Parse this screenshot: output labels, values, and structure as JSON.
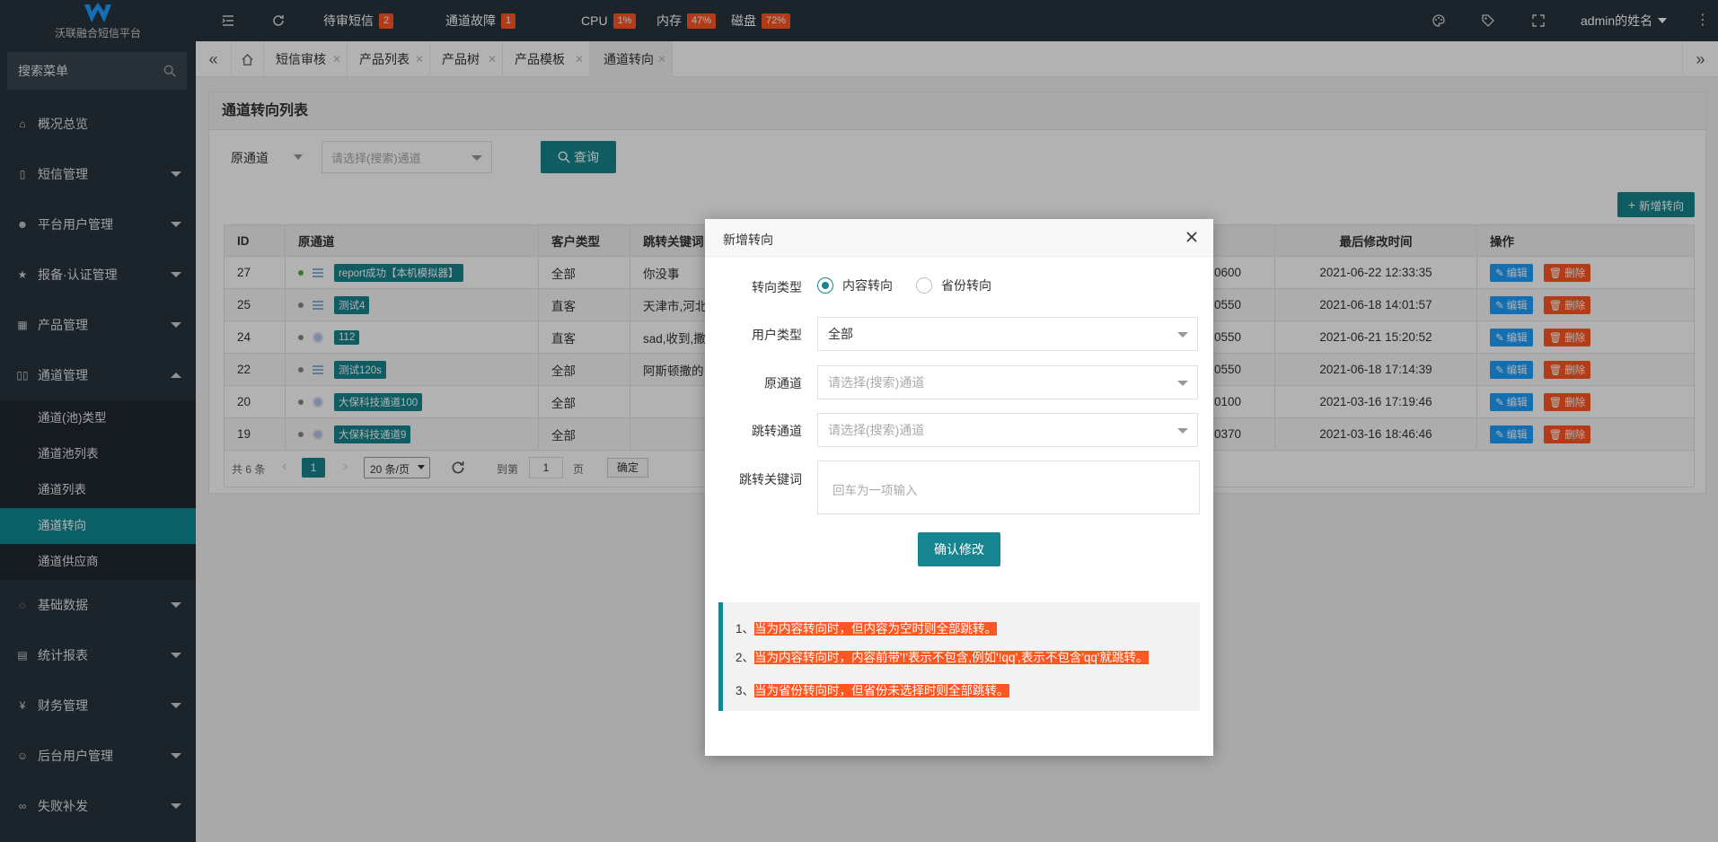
{
  "app": {
    "title": "沃联融合短信平台"
  },
  "sidebar": {
    "search_label": "搜索菜单",
    "items": [
      {
        "label": "概况总览",
        "icon": "home-icon"
      },
      {
        "label": "短信管理",
        "icon": "phone-icon"
      },
      {
        "label": "平台用户管理",
        "icon": "users-icon"
      },
      {
        "label": "报备·认证管理",
        "icon": "star-icon"
      },
      {
        "label": "产品管理",
        "icon": "apps-icon"
      },
      {
        "label": "通道管理",
        "icon": "columns-icon"
      },
      {
        "label": "基础数据",
        "icon": "circle-arrow-icon"
      },
      {
        "label": "统计报表",
        "icon": "table-icon"
      },
      {
        "label": "财务管理",
        "icon": "yen-icon"
      },
      {
        "label": "后台用户管理",
        "icon": "user-icon"
      },
      {
        "label": "失败补发",
        "icon": "link-icon"
      }
    ],
    "subitems": [
      "通道(池)类型",
      "通道池列表",
      "通道列表",
      "通道转向",
      "通道供应商"
    ],
    "active_sub": "通道转向"
  },
  "topbar": {
    "pending_label": "待审短信",
    "pending_count": "2",
    "fault_label": "通道故障",
    "fault_count": "1",
    "cpu_label": "CPU",
    "cpu_value": "1%",
    "mem_label": "内存",
    "mem_value": "47%",
    "disk_label": "磁盘",
    "disk_value": "72%",
    "user": "admin的姓名"
  },
  "tabs": [
    "短信审核",
    "产品列表",
    "产品树",
    "产品模板",
    "通道转向"
  ],
  "page": {
    "title": "通道转向列表",
    "filter_label": "原通道",
    "filter_placeholder": "请选择(搜索)通道",
    "query_button": "查询",
    "add_button": "新增转向",
    "columns": [
      "ID",
      "原通道",
      "客户类型",
      "跳转关键词",
      "最后修改时间",
      "操作"
    ],
    "rows": [
      {
        "id": "27",
        "channel": "report成功【本机模拟器】",
        "type": "全部",
        "kw": "你没事",
        "code": "0600",
        "time": "2021-06-22 12:33:35",
        "dot": "#4caf50",
        "icon": "lines"
      },
      {
        "id": "25",
        "channel": "测试4",
        "type": "直客",
        "kw": "天津市,河北",
        "code": "0550",
        "time": "2021-06-18 14:01:57",
        "dot": "#888888",
        "icon": "lines"
      },
      {
        "id": "24",
        "channel": "112",
        "type": "直客",
        "kw": "sad,收到,撒",
        "code": "0550",
        "time": "2021-06-21 15:20:52",
        "dot": "#888888",
        "icon": "circle"
      },
      {
        "id": "22",
        "channel": "测试120s",
        "type": "全部",
        "kw": "阿斯顿撒的",
        "code": "0550",
        "time": "2021-06-18 17:14:39",
        "dot": "#888888",
        "icon": "lines"
      },
      {
        "id": "20",
        "channel": "大保科技通道100",
        "type": "全部",
        "kw": "",
        "code": "0100",
        "time": "2021-03-16 17:19:46",
        "dot": "#888888",
        "icon": "circle"
      },
      {
        "id": "19",
        "channel": "大保科技通道9",
        "type": "全部",
        "kw": "",
        "code": "0370",
        "time": "2021-03-16 18:46:46",
        "dot": "#888888",
        "icon": "circle"
      }
    ],
    "edit_label": "编辑",
    "delete_label": "删除",
    "pager": {
      "total": "共 6 条",
      "current": "1",
      "per_page": "20 条/页",
      "goto": "到第",
      "page_input": "1",
      "page_unit": "页",
      "confirm": "确定"
    }
  },
  "modal": {
    "title": "新增转向",
    "redirect_type_label": "转向类型",
    "radio_content": "内容转向",
    "radio_province": "省份转向",
    "user_type_label": "用户类型",
    "user_type_value": "全部",
    "src_label": "原通道",
    "src_placeholder": "请选择(搜索)通道",
    "dst_label": "跳转通道",
    "dst_placeholder": "请选择(搜索)通道",
    "kw_label": "跳转关键词",
    "kw_placeholder": "回车为一项输入",
    "confirm_button": "确认修改",
    "tips": [
      {
        "prefix": "1、",
        "text": "当为内容转向时，但内容为空时则全部跳转。"
      },
      {
        "prefix": "2、",
        "text": "当为内容转向时，内容前带'!'表示不包含,例如'!qq',表示不包含'qq'就跳转。"
      },
      {
        "prefix": "3、",
        "text": "当为省份转向时，但省份未选择时则全部跳转。"
      }
    ]
  },
  "colors": {
    "accent": "#17858f",
    "sidebar": "#28333e",
    "badge": "#ff5722",
    "edit": "#1e9fff"
  }
}
